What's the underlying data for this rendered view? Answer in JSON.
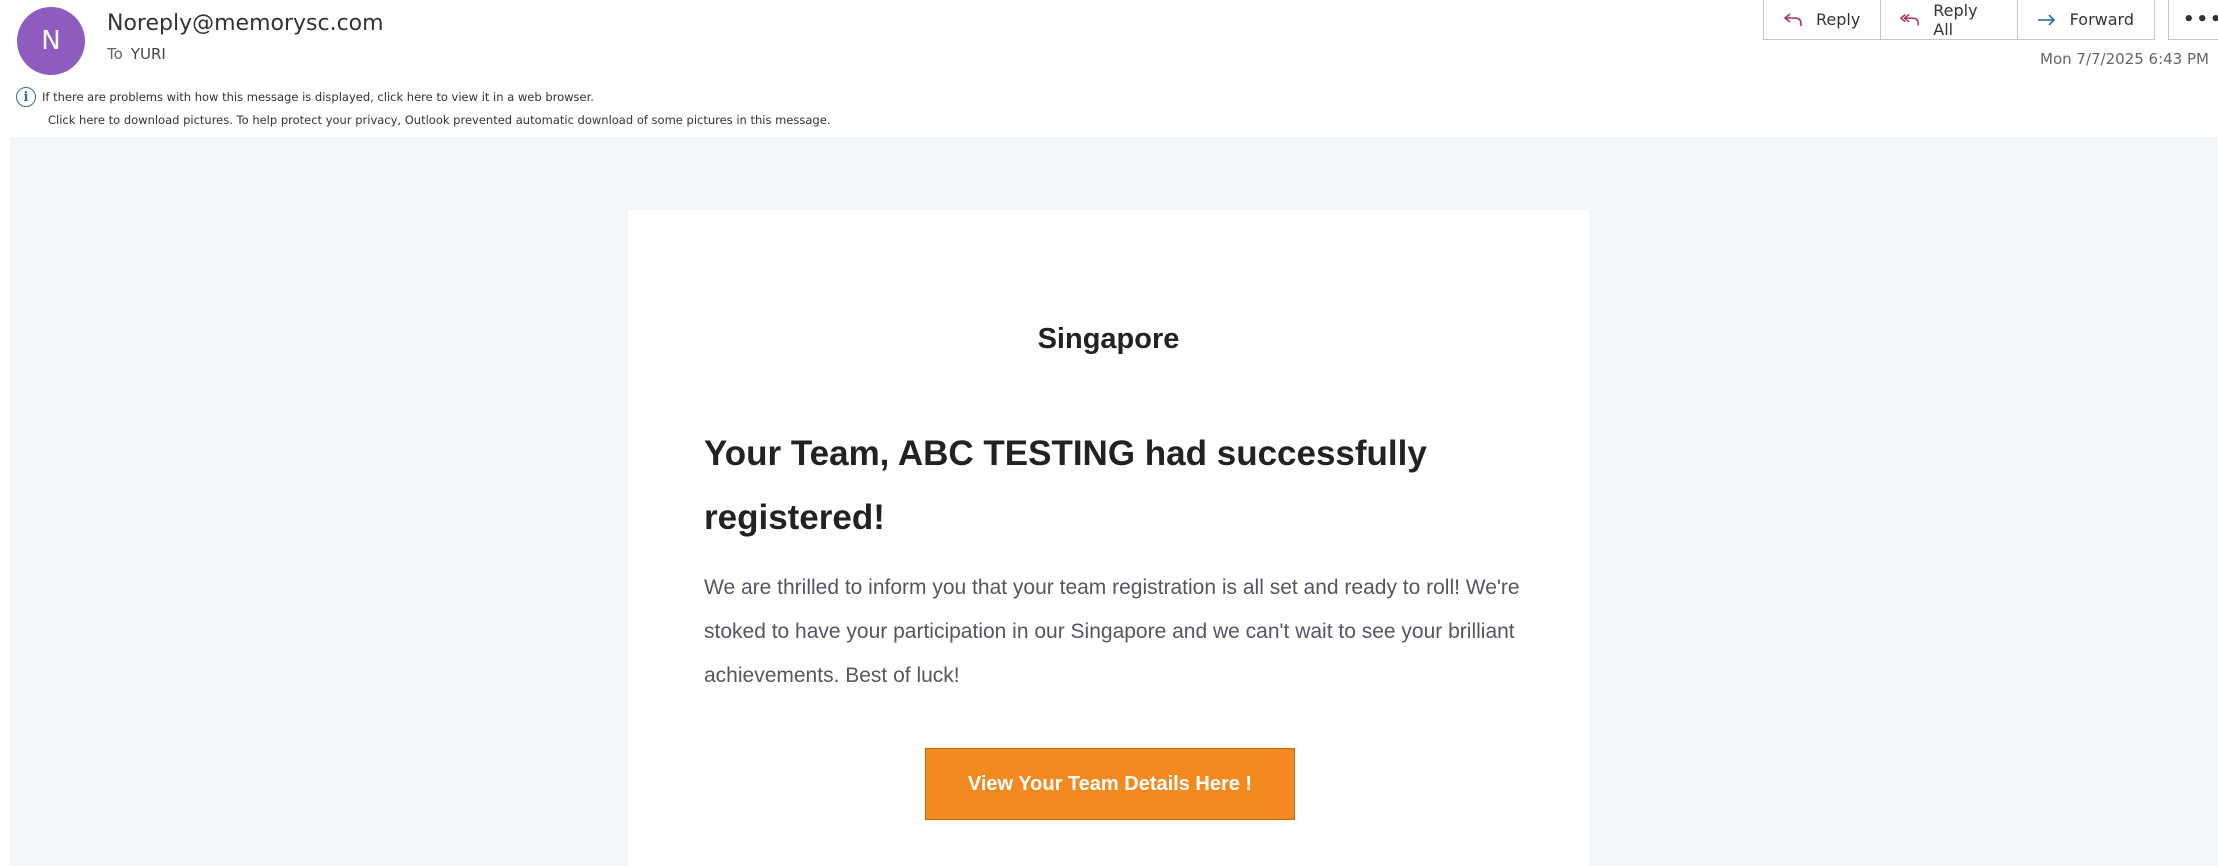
{
  "email": {
    "avatar_letter": "N",
    "sender": "Noreply@memorysc.com",
    "to_label": "To",
    "to_value": "YURI",
    "datetime": "Mon 7/7/2025 6:43 PM"
  },
  "toolbar": {
    "reply_label": "Reply",
    "reply_all_label": "Reply All",
    "forward_label": "Forward",
    "more_label": "•••"
  },
  "notices": {
    "info_icon": "i",
    "display_problem": "If there are problems with how this message is displayed, click here to view it in a web browser.",
    "download_pictures": "Click here to download pictures. To help protect your privacy, Outlook prevented automatic download of some pictures in this message."
  },
  "content": {
    "title": "Singapore",
    "headline": "Your Team, ABC TESTING had successfully registered!",
    "message": "We are thrilled to inform you that your team registration is all set and ready to roll! We're stoked to have your participation in our Singapore and we can't wait to see your brilliant achievements. Best of luck!",
    "cta_label": "View Your Team Details Here !"
  },
  "colors": {
    "avatar": "#8e5bbf",
    "cta": "#f28a1f",
    "body_background": "#f3f6f9",
    "info_icon": "#2b6cb0"
  },
  "icons": {
    "reply": "reply-icon",
    "reply_all": "reply-all-icon",
    "forward": "forward-icon",
    "more": "more-icon",
    "info": "info-icon"
  }
}
